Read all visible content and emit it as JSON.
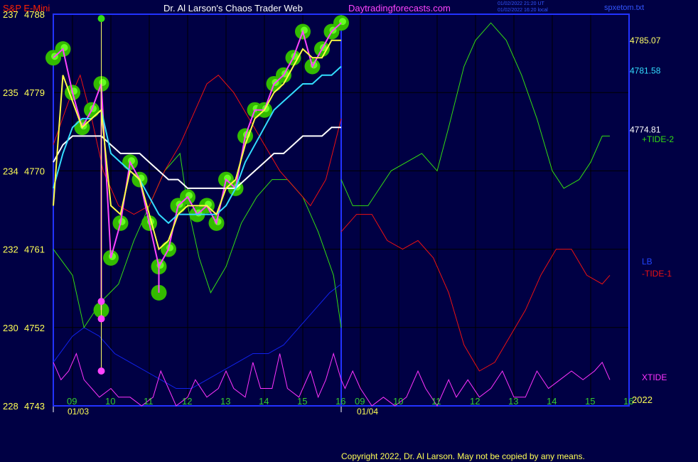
{
  "header": {
    "symbol": "S&P E-Mini",
    "title": "Dr. Al Larson's Chaos Trader Web",
    "site": "Daytradingforecasts.com",
    "stamp_line1": "01/02/2022 21:20 UT",
    "stamp_line2": "01/02/2022 16:20 local",
    "file": "spxetom.txt"
  },
  "copyright": "Copyright 2022, Dr. Al Larson. May not be copied by any means.",
  "colors": {
    "background": "#000044",
    "frame": "#2233ff",
    "grid": "#000000",
    "price_bars": "#ff44ff",
    "price_glow": "#33bb00",
    "price_glow_high": "#66ff22",
    "fast_ma": "#ffff44",
    "mid_ma": "#33ddff",
    "slow_ma": "#ffffff",
    "tide2": "#33dd11",
    "tide1": "#ee1111",
    "lb": "#1122ee",
    "xtide": "#ff33ff",
    "time_labels": "#33cc33",
    "left_labels": "#ffff55",
    "header_symbol": "#ff2200",
    "header_title": "#ffffff",
    "header_site": "#ff44ff",
    "header_stamp": "#3355ff"
  },
  "chart_data": {
    "type": "line",
    "title": "S&P E-Mini",
    "ylim": [
      4743,
      4788
    ],
    "y_ticks": [
      {
        "left": "237",
        "right": "4788",
        "value": 4788
      },
      {
        "left": "235",
        "right": "4779",
        "value": 4779
      },
      {
        "left": "234",
        "right": "4770",
        "value": 4770
      },
      {
        "left": "232",
        "right": "4761",
        "value": 4761
      },
      {
        "left": "230",
        "right": "4752",
        "value": 4752
      },
      {
        "left": "228",
        "right": "4743",
        "value": 4743
      }
    ],
    "x_hour_labels_day1": [
      "09",
      "10",
      "11",
      "12",
      "13",
      "14",
      "15",
      "16"
    ],
    "x_hour_labels_day2": [
      "09",
      "10",
      "11",
      "12",
      "13",
      "14",
      "15",
      "16"
    ],
    "x_dates": [
      "01/03",
      "01/04"
    ],
    "year_label": "2022",
    "price_labels": [
      {
        "text": "4785.07",
        "value": 4785.07,
        "color": "#ffff66"
      },
      {
        "text": "4781.58",
        "value": 4781.58,
        "color": "#33ddff"
      },
      {
        "text": "4774.81",
        "value": 4774.81,
        "color": "#ffffff"
      }
    ],
    "series_labels": [
      {
        "text": "+TIDE-2",
        "color": "#33dd11"
      },
      {
        "text": "LB",
        "color": "#2244ff"
      },
      {
        "text": "-TIDE-1",
        "color": "#ee1111"
      },
      {
        "text": "XTIDE",
        "color": "#ff33ff"
      }
    ],
    "price_hours": [
      8.5,
      8.75,
      9.0,
      9.25,
      9.5,
      9.75,
      10.0,
      10.25,
      10.5,
      10.75,
      11.0,
      11.25,
      11.5,
      11.75,
      12.0,
      12.25,
      12.5,
      12.75,
      13.0,
      13.25,
      13.5,
      13.75,
      14.0,
      14.25,
      14.5,
      14.75,
      15.0,
      15.25,
      15.5,
      15.75,
      16.0
    ],
    "price": [
      4783,
      4784,
      4779,
      4775,
      4777,
      4780,
      4760,
      4764,
      4771,
      4769,
      4764,
      4759,
      4761,
      4766,
      4767,
      4765,
      4766,
      4764,
      4769,
      4768,
      4774,
      4777,
      4777,
      4780,
      4781,
      4783,
      4786,
      4782,
      4784,
      4786,
      4787
    ],
    "price_low_spikes": [
      {
        "hour": 9.75,
        "value": 4754
      },
      {
        "hour": 11.25,
        "value": 4756
      }
    ],
    "fast_ma": [
      4766,
      4781,
      4778,
      4775,
      4776,
      4777,
      4766,
      4765,
      4770,
      4769,
      4765,
      4761,
      4762,
      4765,
      4766,
      4766,
      4766,
      4765,
      4768,
      4769,
      4773,
      4776,
      4777,
      4779,
      4780,
      4782,
      4784,
      4783,
      4783,
      4785,
      4785
    ],
    "mid_ma": [
      4768,
      4772,
      4775,
      4776,
      4776,
      4777,
      4772,
      4771,
      4770,
      4769,
      4767,
      4765,
      4764,
      4765,
      4765,
      4765,
      4765,
      4765,
      4766,
      4768,
      4771,
      4773,
      4775,
      4777,
      4778,
      4779,
      4780,
      4780,
      4781,
      4781,
      4782
    ],
    "slow_ma": [
      4771,
      4773,
      4774,
      4774,
      4774,
      4774,
      4773,
      4772,
      4772,
      4772,
      4771,
      4770,
      4769,
      4769,
      4768,
      4768,
      4768,
      4768,
      4768,
      4768,
      4769,
      4770,
      4771,
      4772,
      4772,
      4773,
      4774,
      4774,
      4774,
      4775,
      4775
    ],
    "swing_markers": [
      {
        "hour": 9.75,
        "value": 4787.5,
        "color": "#33dd11"
      },
      {
        "hour": 9.75,
        "value": 4755,
        "color": "#ff44ff"
      },
      {
        "hour": 9.75,
        "value": 4753,
        "color": "#ff44ff"
      },
      {
        "hour": 9.75,
        "value": 4747,
        "color": "#ff44ff"
      }
    ],
    "tide2": [
      [
        8.5,
        4761
      ],
      [
        9.0,
        4758
      ],
      [
        9.3,
        4752
      ],
      [
        9.75,
        4755
      ],
      [
        10.2,
        4757
      ],
      [
        10.6,
        4762
      ],
      [
        11.0,
        4766
      ],
      [
        11.4,
        4770
      ],
      [
        11.8,
        4772
      ],
      [
        12.0,
        4766
      ],
      [
        12.3,
        4760
      ],
      [
        12.6,
        4756
      ],
      [
        13.0,
        4759
      ],
      [
        13.4,
        4764
      ],
      [
        13.8,
        4767
      ],
      [
        14.2,
        4769
      ],
      [
        14.6,
        4769
      ],
      [
        15.0,
        4767
      ],
      [
        15.4,
        4763
      ],
      [
        15.8,
        4758
      ],
      [
        16.0,
        4752
      ],
      [
        16.0,
        4769
      ],
      [
        16.3,
        4766
      ],
      [
        16.7,
        4766
      ],
      [
        17.0,
        4768
      ],
      [
        17.3,
        4770
      ],
      [
        17.7,
        4771
      ],
      [
        18.1,
        4772
      ],
      [
        18.5,
        4770
      ],
      [
        18.8,
        4775
      ],
      [
        19.2,
        4782
      ],
      [
        19.5,
        4785
      ],
      [
        19.9,
        4787
      ],
      [
        20.3,
        4785
      ],
      [
        20.7,
        4781
      ],
      [
        21.1,
        4776
      ],
      [
        21.5,
        4770
      ],
      [
        21.8,
        4768
      ],
      [
        22.2,
        4769
      ],
      [
        22.5,
        4771
      ],
      [
        22.8,
        4774
      ],
      [
        23.0,
        4774
      ]
    ],
    "tide1": [
      [
        8.5,
        4773
      ],
      [
        8.9,
        4778
      ],
      [
        9.2,
        4781
      ],
      [
        9.5,
        4776
      ],
      [
        9.8,
        4770
      ],
      [
        10.2,
        4766
      ],
      [
        10.6,
        4765
      ],
      [
        11.0,
        4766
      ],
      [
        11.4,
        4770
      ],
      [
        11.8,
        4773
      ],
      [
        12.2,
        4777
      ],
      [
        12.5,
        4780
      ],
      [
        12.8,
        4781
      ],
      [
        13.2,
        4779
      ],
      [
        13.6,
        4776
      ],
      [
        14.0,
        4773
      ],
      [
        14.4,
        4770
      ],
      [
        14.8,
        4768
      ],
      [
        15.2,
        4766
      ],
      [
        15.6,
        4769
      ],
      [
        16.0,
        4776
      ],
      [
        16.0,
        4763
      ],
      [
        16.4,
        4765
      ],
      [
        16.8,
        4765
      ],
      [
        17.2,
        4762
      ],
      [
        17.6,
        4761
      ],
      [
        18.0,
        4762
      ],
      [
        18.4,
        4760
      ],
      [
        18.8,
        4756
      ],
      [
        19.2,
        4750
      ],
      [
        19.6,
        4747
      ],
      [
        20.0,
        4748
      ],
      [
        20.4,
        4751
      ],
      [
        20.8,
        4754
      ],
      [
        21.2,
        4758
      ],
      [
        21.6,
        4761
      ],
      [
        22.0,
        4761
      ],
      [
        22.4,
        4758
      ],
      [
        22.8,
        4757
      ],
      [
        23.0,
        4758
      ]
    ],
    "lb": [
      [
        8.5,
        4748
      ],
      [
        9.0,
        4751
      ],
      [
        9.3,
        4752
      ],
      [
        9.7,
        4751
      ],
      [
        10.1,
        4749
      ],
      [
        10.5,
        4748
      ],
      [
        10.9,
        4747
      ],
      [
        11.3,
        4746
      ],
      [
        11.7,
        4745
      ],
      [
        12.1,
        4745
      ],
      [
        12.5,
        4746
      ],
      [
        12.9,
        4747
      ],
      [
        13.3,
        4748
      ],
      [
        13.7,
        4749
      ],
      [
        14.1,
        4749
      ],
      [
        14.5,
        4750
      ],
      [
        14.9,
        4752
      ],
      [
        15.3,
        4754
      ],
      [
        15.7,
        4756
      ],
      [
        16.0,
        4757
      ]
    ],
    "xtide": [
      [
        8.5,
        4748
      ],
      [
        8.7,
        4746
      ],
      [
        8.9,
        4747
      ],
      [
        9.1,
        4749
      ],
      [
        9.3,
        4746
      ],
      [
        9.5,
        4745
      ],
      [
        9.7,
        4744
      ],
      [
        10.0,
        4745
      ],
      [
        10.2,
        4744
      ],
      [
        10.5,
        4744
      ],
      [
        10.8,
        4743
      ],
      [
        11.1,
        4744
      ],
      [
        11.3,
        4747
      ],
      [
        11.5,
        4745
      ],
      [
        11.7,
        4743
      ],
      [
        12.0,
        4744
      ],
      [
        12.2,
        4746
      ],
      [
        12.5,
        4744
      ],
      [
        12.8,
        4745
      ],
      [
        13.0,
        4747
      ],
      [
        13.2,
        4745
      ],
      [
        13.5,
        4744
      ],
      [
        13.7,
        4748
      ],
      [
        13.9,
        4745
      ],
      [
        14.2,
        4745
      ],
      [
        14.4,
        4749
      ],
      [
        14.6,
        4745
      ],
      [
        14.9,
        4744
      ],
      [
        15.2,
        4747
      ],
      [
        15.4,
        4744
      ],
      [
        15.6,
        4746
      ],
      [
        15.8,
        4749
      ],
      [
        16.0,
        4746
      ],
      [
        16.1,
        4745
      ],
      [
        16.3,
        4747
      ],
      [
        16.5,
        4745
      ],
      [
        16.8,
        4743
      ],
      [
        17.1,
        4744
      ],
      [
        17.4,
        4743
      ],
      [
        17.7,
        4744
      ],
      [
        18.0,
        4747
      ],
      [
        18.2,
        4745
      ],
      [
        18.5,
        4743
      ],
      [
        18.8,
        4746
      ],
      [
        19.0,
        4744
      ],
      [
        19.3,
        4746
      ],
      [
        19.6,
        4744
      ],
      [
        19.9,
        4745
      ],
      [
        20.2,
        4747
      ],
      [
        20.5,
        4744
      ],
      [
        20.8,
        4744
      ],
      [
        21.1,
        4747
      ],
      [
        21.4,
        4745
      ],
      [
        21.7,
        4746
      ],
      [
        22.0,
        4747
      ],
      [
        22.3,
        4746
      ],
      [
        22.6,
        4747
      ],
      [
        22.8,
        4748
      ],
      [
        23.0,
        4746
      ]
    ]
  }
}
